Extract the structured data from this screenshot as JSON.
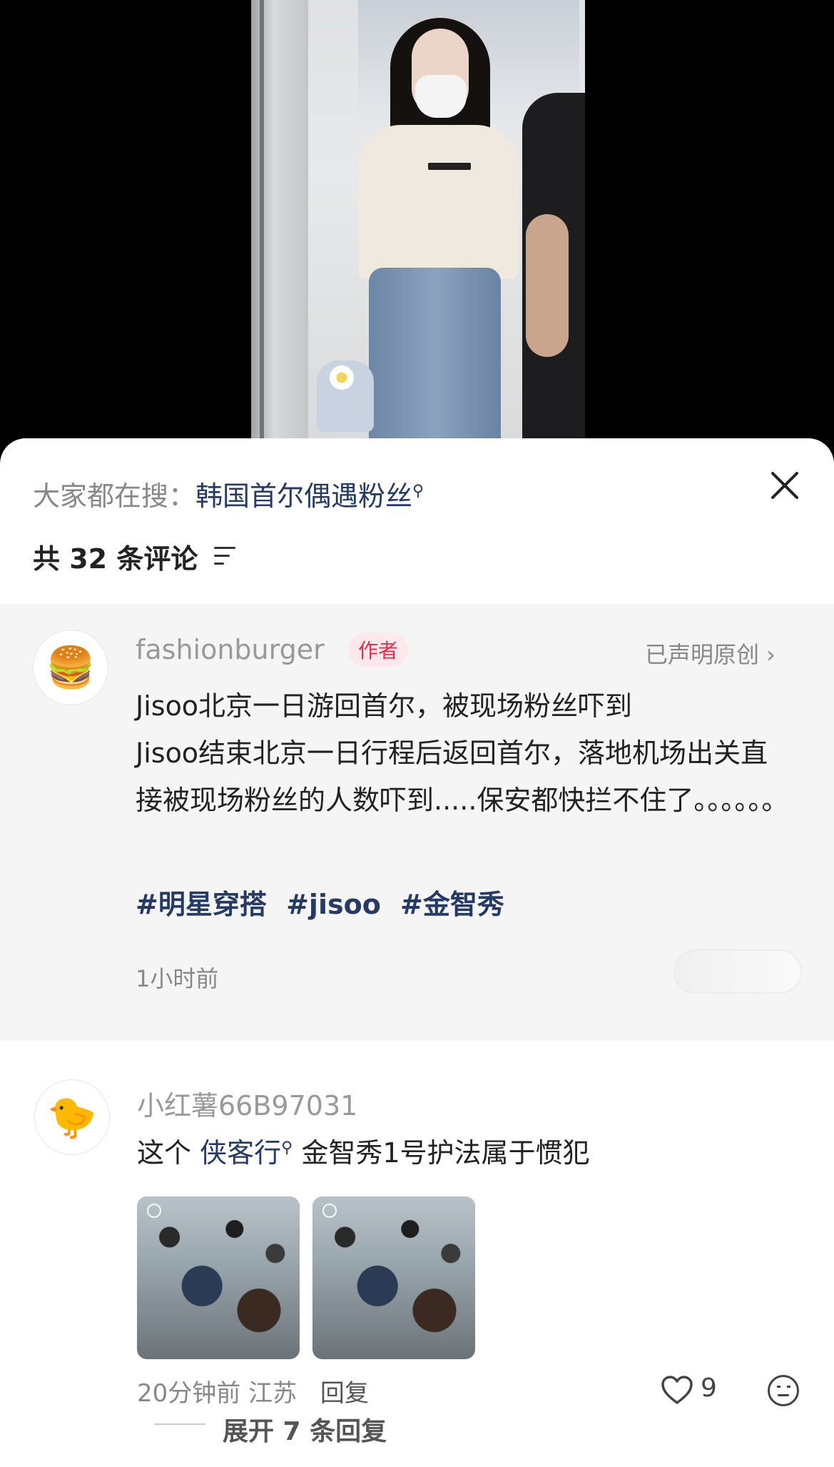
{
  "media": {
    "description_icon": "video-frame"
  },
  "sheet": {
    "search_prefix": "大家都在搜：",
    "search_term": "韩国首尔偶遇粉丝",
    "search_icon": "search-icon",
    "count_label": "共 32 条评论",
    "sort_icon": "sort-icon"
  },
  "author_post": {
    "avatar_emoji": "🍔",
    "name": "fashionburger",
    "tag": "作者",
    "original_label": "已声明原创 ›",
    "title": "Jisoo北京一日游回首尔，被现场粉丝吓到",
    "body": "Jisoo结束北京一日行程后返回首尔，落地机场出关直接被现场粉丝的人数吓到.....保安都快拦不住了。。。。。。",
    "tags": [
      "#明星穿搭",
      "#jisoo",
      "#金智秀"
    ],
    "time": "1小时前"
  },
  "reply": {
    "avatar_emoji": "🐤",
    "name": "小红薯66B97031",
    "text_before": "这个 ",
    "link": "侠客行",
    "text_after": " 金智秀1号护法属于惯犯",
    "time": "20分钟前",
    "location": "江苏",
    "reply_label": "回复",
    "likes": "9",
    "expand_label": "展开 7 条回复"
  },
  "colors": {
    "link": "#253a64",
    "author_tag": "#e0314a",
    "muted": "#888888"
  }
}
